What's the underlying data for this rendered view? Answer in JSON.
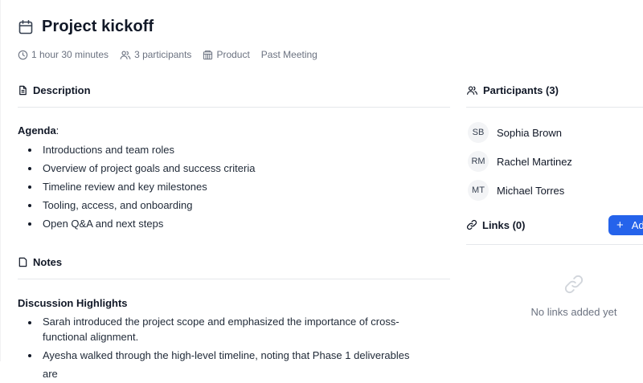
{
  "meeting": {
    "title": "Project kickoff",
    "duration": "1 hour 30 minutes",
    "participants_count": "3 participants",
    "department": "Product",
    "status": "Past Meeting"
  },
  "description": {
    "heading": "Description",
    "agenda_label": "Agenda",
    "agenda_colon": ":",
    "agenda_items": [
      "Introductions and team roles",
      "Overview of project goals and success criteria",
      "Timeline review and key milestones",
      "Tooling, access, and onboarding",
      "Open Q&A and next steps"
    ]
  },
  "notes": {
    "heading": "Notes",
    "subheading": "Discussion Highlights",
    "items": [
      "Sarah introduced the project scope and emphasized the importance of cross-functional alignment.",
      "Ayesha walked through the high-level timeline, noting that Phase 1 deliverables are"
    ]
  },
  "participants": {
    "heading": "Participants (3)",
    "list": [
      {
        "initials": "SB",
        "name": "Sophia Brown"
      },
      {
        "initials": "RM",
        "name": "Rachel Martinez"
      },
      {
        "initials": "MT",
        "name": "Michael Torres"
      }
    ]
  },
  "links": {
    "heading": "Links (0)",
    "add_button_label": "Ad",
    "add_button_icon": "+",
    "empty_text": "No links added yet"
  },
  "colors": {
    "accent": "#2563eb",
    "muted_text": "#6b7280",
    "divider": "#e5e7eb"
  }
}
